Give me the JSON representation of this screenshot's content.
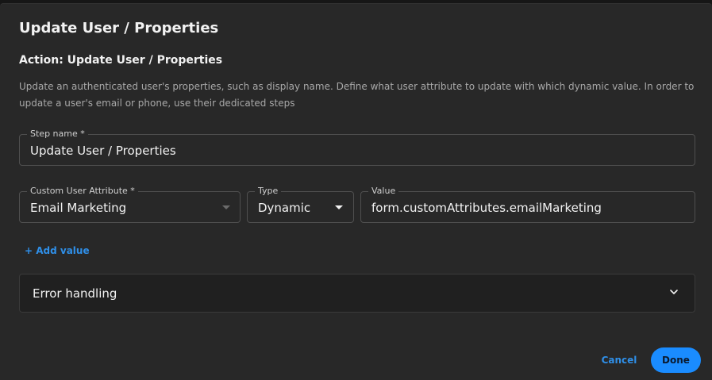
{
  "dialog": {
    "title": "Update User / Properties",
    "action_title": "Action: Update User / Properties",
    "description": "Update an authenticated user's properties, such as display name. Define what user attribute to update with which dynamic value. In order to update a user's email or phone, use their dedicated steps"
  },
  "step_name": {
    "label": "Step name *",
    "value": "Update User / Properties"
  },
  "attribute_row": {
    "custom_attribute": {
      "label": "Custom User Attribute *",
      "value": "Email Marketing"
    },
    "type": {
      "label": "Type",
      "value": "Dynamic"
    },
    "value": {
      "label": "Value",
      "value": "form.customAttributes.emailMarketing"
    }
  },
  "add_value_label": "+ Add value",
  "error_handling": {
    "label": "Error handling"
  },
  "footer": {
    "cancel_label": "Cancel",
    "done_label": "Done"
  },
  "colors": {
    "accent": "#1a8cff",
    "link": "#2f8fe8",
    "background": "#282828"
  },
  "icons": {
    "dropdown": "chevron-down-icon",
    "accordion": "chevron-down-icon"
  }
}
